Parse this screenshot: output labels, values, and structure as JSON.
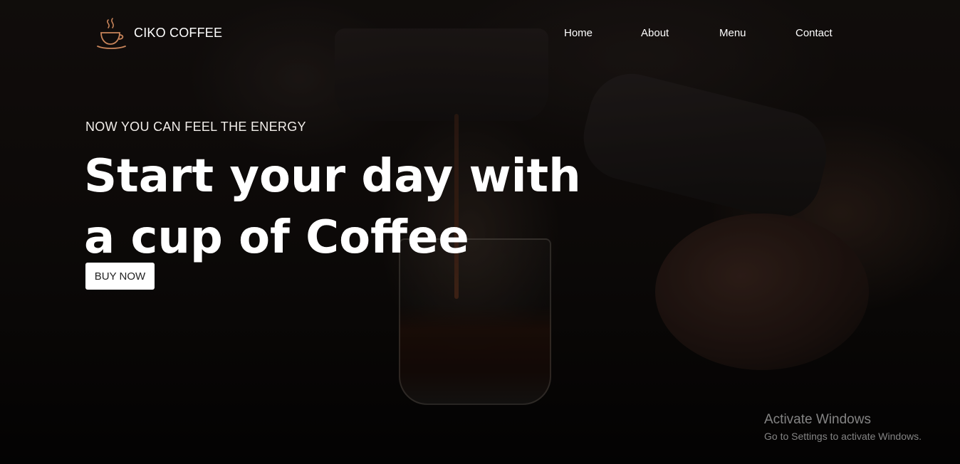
{
  "brand": {
    "name": "CIKO COFFEE",
    "icon": "coffee-cup-icon",
    "accent_color": "#c8845a"
  },
  "nav": {
    "items": [
      {
        "label": "Home"
      },
      {
        "label": "About"
      },
      {
        "label": "Menu"
      },
      {
        "label": "Contact"
      }
    ]
  },
  "hero": {
    "tagline": "NOW YOU CAN FEEL THE ENERGY",
    "headline_line1": "Start your day with",
    "headline_line2": "a cup of Coffee",
    "cta_label": "BUY NOW"
  },
  "watermark": {
    "title": "Activate Windows",
    "subtitle": "Go to Settings to activate Windows."
  }
}
